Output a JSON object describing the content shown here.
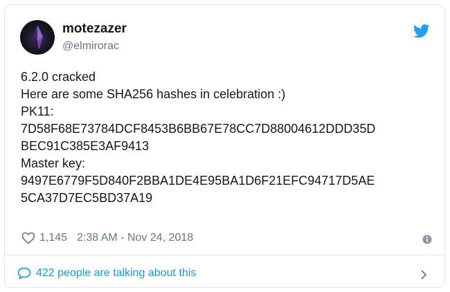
{
  "author": {
    "display_name": "motezazer",
    "handle": "@elmirorac"
  },
  "tweet": {
    "lines": [
      "6.2.0 cracked",
      "Here are some SHA256 hashes in celebration :)",
      "PK11:",
      "7D58F68E73784DCF8453B6BB67E78CC7D88004612DDD35D",
      "BEC91C385E3AF9413",
      "Master key:",
      "9497E6779F5D840F2BBA1DE4E95BA1D6F21EFC94717D5AE",
      "5CA37D7EC5BD37A19"
    ]
  },
  "meta": {
    "like_count": "1,145",
    "timestamp": "2:38 AM - Nov 24, 2018"
  },
  "conversation": {
    "label": "422 people are talking about this"
  },
  "icons": {
    "brand": "twitter-bird-icon",
    "like": "heart-icon",
    "info": "info-icon",
    "reply": "chat-bubble-icon",
    "chevron": "chevron-right-icon"
  },
  "colors": {
    "brand": "#1da1f2",
    "link": "#1b95e0",
    "muted": "#657786",
    "text": "#14171a",
    "border": "#e1e8ed"
  }
}
